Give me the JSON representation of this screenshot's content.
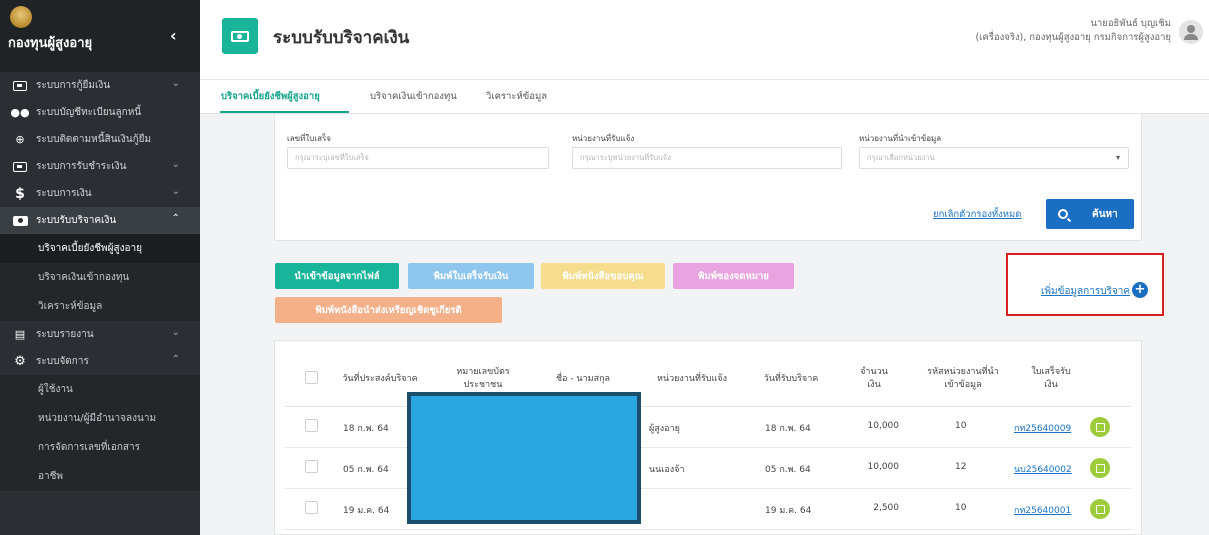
{
  "sidebar": {
    "brand": "กองทุนผู้สูงอายุ",
    "collapse_icon": "chevron-left-icon",
    "items": [
      {
        "label": "ระบบการกู้ยืมเงิน",
        "icon": "id-card-icon",
        "chevron": "⌄"
      },
      {
        "label": "ระบบบัญชีทะเบียนลูกหนี้",
        "icon": "users-icon",
        "chevron": ""
      },
      {
        "label": "ระบบติดตามหนี้สินเงินกู้ยืม",
        "icon": "crosshair-icon",
        "chevron": ""
      },
      {
        "label": "ระบบการรับชำระเงิน",
        "icon": "money-icon",
        "chevron": "⌄"
      },
      {
        "label": "ระบบการเงิน",
        "icon": "dollar-icon",
        "chevron": "⌄"
      },
      {
        "label": "ระบบรับบริจาคเงิน",
        "icon": "money-icon",
        "chevron": "⌃"
      }
    ],
    "donation_sub": [
      {
        "label": "บริจาคเบี้ยยังชีพผู้สูงอายุ"
      },
      {
        "label": "บริจาคเงินเข้ากองทุน"
      },
      {
        "label": "วิเคราะห์ข้อมูล"
      }
    ],
    "report_item": {
      "label": "ระบบรายงาน",
      "icon": "document-icon",
      "chevron": "⌄"
    },
    "admin_item": {
      "label": "ระบบจัดการ",
      "icon": "gears-icon",
      "chevron": "⌃"
    },
    "admin_sub": [
      {
        "label": "ผู้ใช้งาน"
      },
      {
        "label": "หน่วยงาน/ผู้มีอำนาจลงนาม"
      },
      {
        "label": "การจัดการเลขที่เอกสาร"
      },
      {
        "label": "อาชีพ"
      }
    ]
  },
  "header": {
    "title": "ระบบรับบริจาคเงิน",
    "user_name": "นายอธิพันธ์ บุญเชิม",
    "user_org": "(เครื่องจริง), กองทุนผู้สูงอายุ กรมกิจการผู้สูงอายุ"
  },
  "tabs": [
    {
      "label": "บริจาคเบี้ยยังชีพผู้สูงอายุ",
      "active": true
    },
    {
      "label": "บริจาคเงินเข้ากองทุน",
      "active": false
    },
    {
      "label": "วิเคราะห์ข้อมูล",
      "active": false
    }
  ],
  "filters": {
    "receipt_label": "เลขที่ใบเสร็จ",
    "receipt_placeholder": "กรุณาระบุเลขที่ใบเสร็จ",
    "agency_label": "หน่วยงานที่รับแจ้ง",
    "agency_placeholder": "กรุณาระบุหน่วยงานที่รับแจ้ง",
    "import_agency_label": "หน่วยงานที่นำเข้าข้อมูล",
    "import_agency_placeholder": "กรุณาเลือกหน่วยงาน",
    "clear_all": "ยกเลิกตัวกรองทั้งหมด",
    "search": "ค้นหา"
  },
  "actions": {
    "import_file": "นำเข้าข้อมูลจากไฟล์",
    "print_receipt": "พิมพ์ใบเสร็จรับเงิน",
    "print_thanks": "พิมพ์หนังสือขอบคุณ",
    "print_envelope": "พิมพ์ซองจดหมาย",
    "print_medal_letter": "พิมพ์หนังสือนำส่งเหรียญเชิดชูเกียรติ",
    "add_donation": "เพิ่มข้อมูลการบริจาค",
    "colors": {
      "teal": "#18b59a",
      "light_blue": "#8fc6ef",
      "light_yellow": "#f6dd8e",
      "pink": "#e8a3e0",
      "salmon": "#f4b089",
      "highlight_border": "#d61f1f"
    }
  },
  "table": {
    "headers": {
      "intent_date": "วันที่ประสงค์บริจาค",
      "id_number_1": "หมายเลขบัตร",
      "id_number_2": "ประชาชน",
      "name": "ชื่อ - นามสกุล",
      "agency": "หน่วยงานที่รับแจ้ง",
      "receive_date": "วันที่รับบริจาค",
      "amount_1": "จำนวน",
      "amount_2": "เงิน",
      "import_code_1": "รหัสหน่วยงานที่นำ",
      "import_code_2": "เข้าข้อมูล",
      "receipt_1": "ใบเสร็จรับ",
      "receipt_2": "เงิน"
    },
    "rows": [
      {
        "intent_date": "18 ก.พ. 64",
        "agency": "ผู้สูงอายุ",
        "receive_date": "18 ก.พ. 64",
        "amount": "10,000",
        "import_code": "10",
        "receipt": "กท25640009"
      },
      {
        "intent_date": "05 ก.พ. 64",
        "agency": "นนเองจ้า",
        "receive_date": "05 ก.พ. 64",
        "amount": "10,000",
        "import_code": "12",
        "receipt": "นบ25640002"
      },
      {
        "intent_date": "19 ม.ค. 64",
        "agency": "",
        "receive_date": "19 ม.ค. 64",
        "amount": "2,500",
        "import_code": "10",
        "receipt": "กท25640001"
      }
    ]
  }
}
